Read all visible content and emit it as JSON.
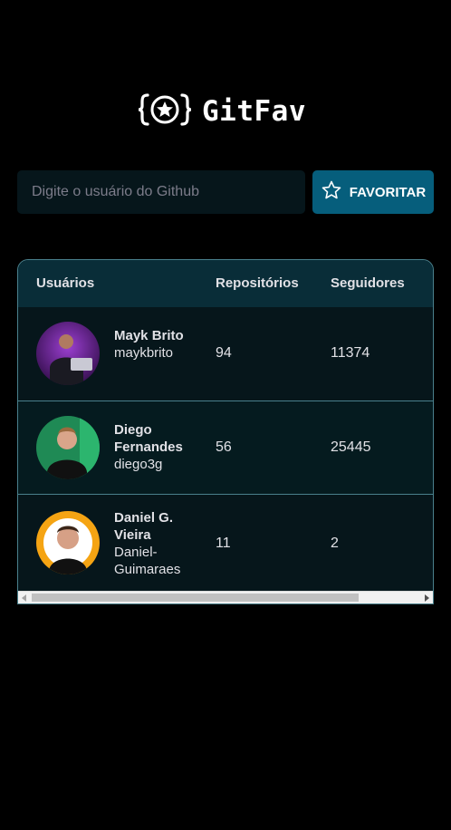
{
  "app": {
    "title": "GitFav",
    "logo_icon": "star-in-braces-icon"
  },
  "search": {
    "placeholder": "Digite o usuário do Github",
    "value": "",
    "button_label": "FAVORITAR",
    "button_icon": "star-outline-icon"
  },
  "table": {
    "headers": {
      "users": "Usuários",
      "repos": "Repositórios",
      "followers": "Seguidores"
    },
    "rows": [
      {
        "name": "Mayk Brito",
        "login": "maykbrito",
        "repos": "94",
        "followers": "11374"
      },
      {
        "name": "Diego Fernandes",
        "login": "diego3g",
        "repos": "56",
        "followers": "25445"
      },
      {
        "name": "Daniel G. Vieira",
        "login": "Daniel-Guimaraes",
        "repos": "11",
        "followers": "2"
      }
    ]
  },
  "colors": {
    "background": "#000000",
    "accent": "#065E7C",
    "table_header": "#092D38",
    "row": "#06161B",
    "border": "#4A808C"
  }
}
